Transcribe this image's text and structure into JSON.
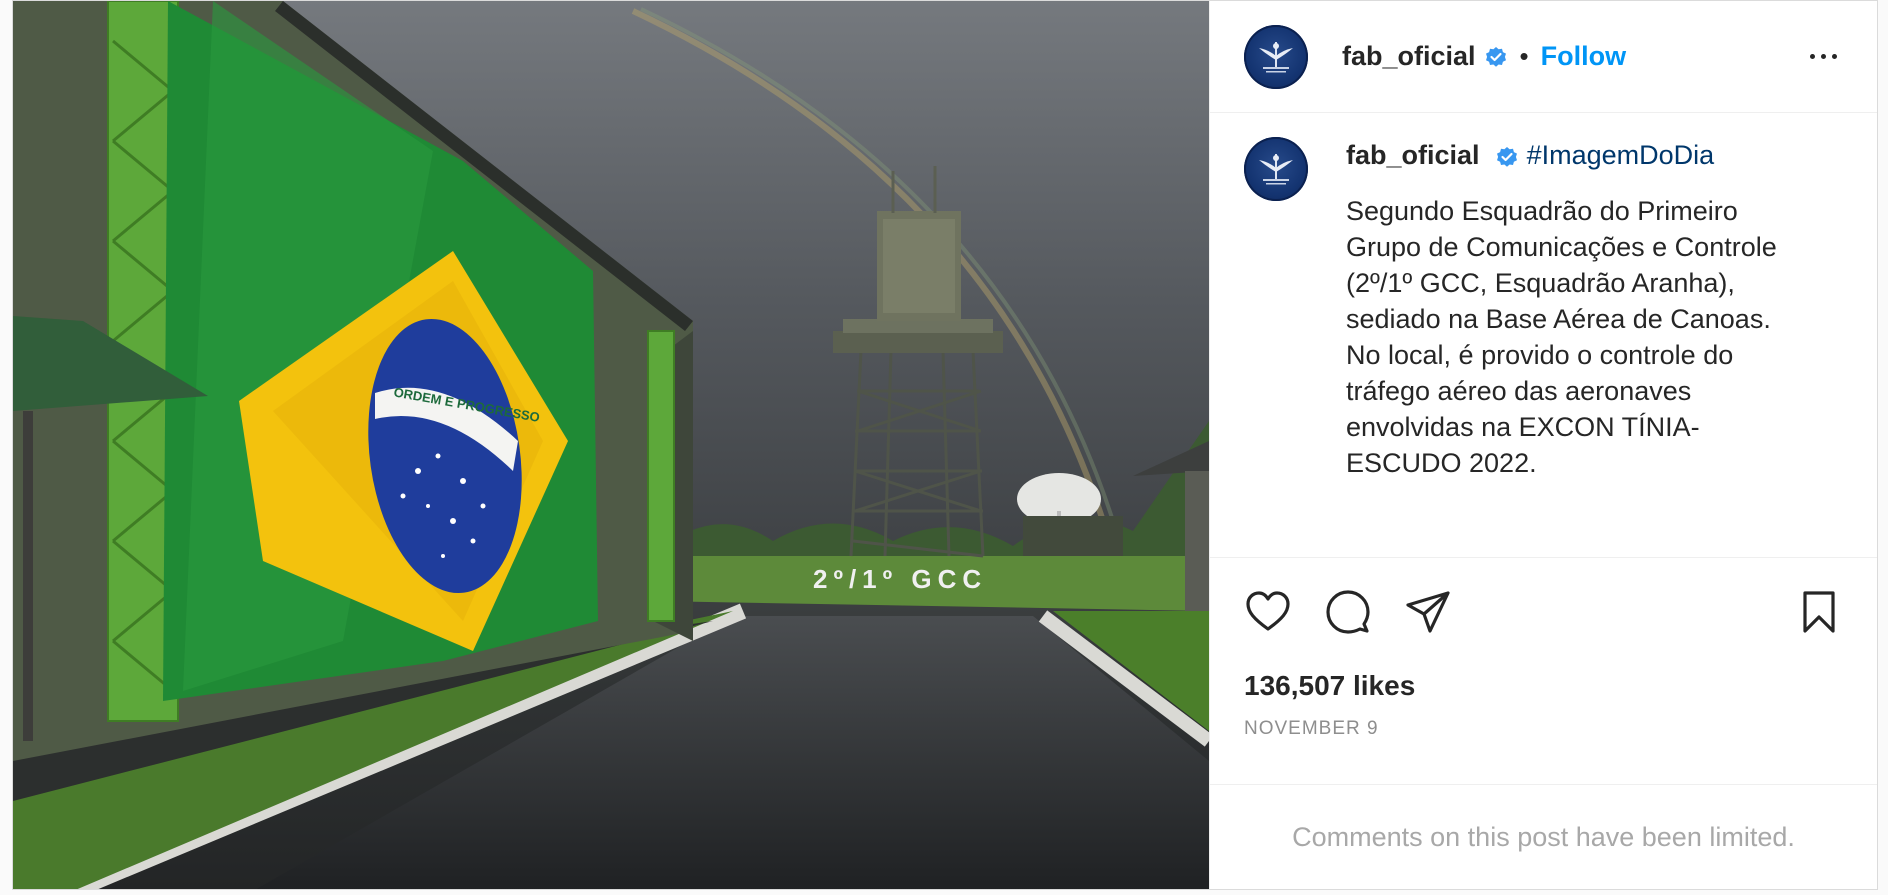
{
  "post": {
    "photo": {
      "flag_motto": "ORDEM E PROGRESSO",
      "ground_lettering": "2º/1º GCC"
    },
    "header": {
      "username": "fab_oficial",
      "dot": "•",
      "follow_label": "Follow",
      "avatar_icon": "eagle-emblem-icon",
      "verified_icon": "verified-badge-icon",
      "more_icon": "more-options-icon"
    },
    "caption": {
      "username": "fab_oficial",
      "hashtag": "#ImagemDoDia",
      "text": "Segundo Esquadrão do Primeiro\nGrupo de Comunicações e Controle\n(2º/1º GCC, Esquadrão Aranha),\nsediado na Base Aérea de Canoas.\nNo local, é provido o controle do\ntráfego aéreo das aeronaves\nenvolvidas na EXCON TÍNIA-\nESCUDO 2022."
    },
    "actions": {
      "like_icon": "heart-icon",
      "comment_icon": "comment-icon",
      "share_icon": "share-icon",
      "save_icon": "bookmark-icon"
    },
    "likes": "136,507 likes",
    "date": "NOVEMBER 9",
    "comments_notice": "Comments on this post have been limited."
  },
  "colors": {
    "accent": "#0095f6",
    "verified": "#3897f0",
    "hashtag": "#00376b",
    "muted": "#8e8e8e"
  }
}
